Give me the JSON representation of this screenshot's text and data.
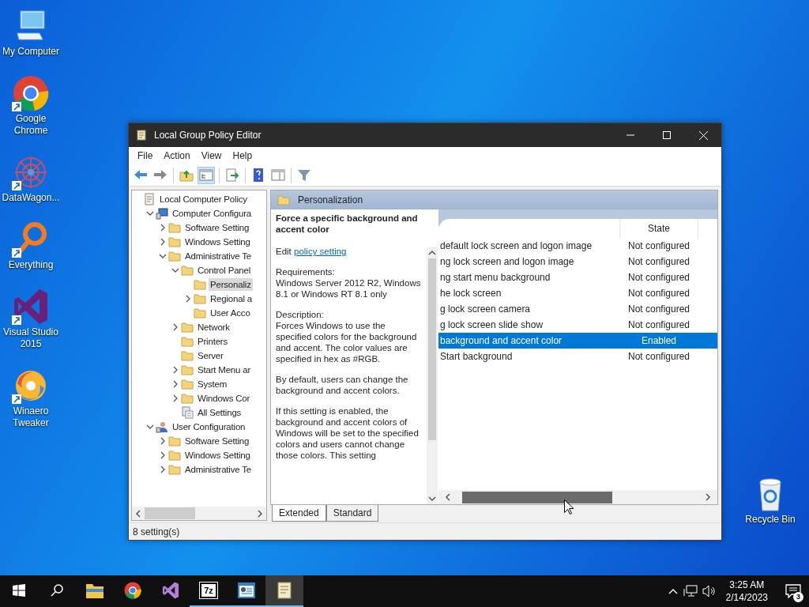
{
  "desktop_icons": [
    {
      "label": "My Computer",
      "kind": "computer",
      "shortcut": false
    },
    {
      "label": "Google Chrome",
      "kind": "chrome",
      "shortcut": true
    },
    {
      "label": "DataWagon...",
      "kind": "mandala",
      "shortcut": true
    },
    {
      "label": "Everything",
      "kind": "magnifier",
      "shortcut": true
    },
    {
      "label": "Visual Studio 2015",
      "kind": "vs",
      "shortcut": true
    },
    {
      "label": "Winaero Tweaker",
      "kind": "swirl",
      "shortcut": true
    },
    {
      "label": "Recycle Bin",
      "kind": "bin",
      "shortcut": false
    }
  ],
  "window": {
    "title": "Local Group Policy Editor",
    "menu": [
      "File",
      "Action",
      "View",
      "Help"
    ],
    "toolbar": [
      {
        "kind": "back"
      },
      {
        "kind": "forward"
      },
      {
        "kind": "sep"
      },
      {
        "kind": "up",
        "selected": false
      },
      {
        "kind": "tree",
        "selected": true
      },
      {
        "kind": "sep"
      },
      {
        "kind": "export",
        "selected": false
      },
      {
        "kind": "sep"
      },
      {
        "kind": "help",
        "selected": false
      },
      {
        "kind": "pane",
        "selected": false
      },
      {
        "kind": "sep"
      },
      {
        "kind": "filter",
        "selected": false
      }
    ],
    "tree": [
      {
        "label": "Local Computer Policy",
        "kind": "policy",
        "selected": false,
        "children": [
          {
            "label": "Computer Configura",
            "kind": "computer",
            "expanded": true,
            "selected": false,
            "children": [
              {
                "label": "Software Setting",
                "kind": "folder",
                "expanded": false,
                "selected": false
              },
              {
                "label": "Windows Setting",
                "kind": "folder",
                "expanded": false,
                "selected": false
              },
              {
                "label": "Administrative Te",
                "kind": "folder",
                "expanded": true,
                "selected": false,
                "children": [
                  {
                    "label": "Control Panel",
                    "kind": "folder",
                    "expanded": true,
                    "selected": false,
                    "children": [
                      {
                        "label": "Personaliz",
                        "kind": "folder",
                        "selected": true
                      },
                      {
                        "label": "Regional a",
                        "kind": "folder",
                        "expanded": false,
                        "selected": false
                      },
                      {
                        "label": "User Acco",
                        "kind": "folder",
                        "selected": false
                      }
                    ]
                  },
                  {
                    "label": "Network",
                    "kind": "folder",
                    "expanded": false,
                    "selected": false
                  },
                  {
                    "label": "Printers",
                    "kind": "folder",
                    "selected": false
                  },
                  {
                    "label": "Server",
                    "kind": "folder",
                    "selected": false
                  },
                  {
                    "label": "Start Menu ar",
                    "kind": "folder",
                    "expanded": false,
                    "selected": false
                  },
                  {
                    "label": "System",
                    "kind": "folder",
                    "expanded": false,
                    "selected": false
                  },
                  {
                    "label": "Windows Cor",
                    "kind": "folder",
                    "expanded": false,
                    "selected": false
                  },
                  {
                    "label": "All Settings",
                    "kind": "settings",
                    "selected": false
                  }
                ]
              }
            ]
          },
          {
            "label": "User Configuration",
            "kind": "user",
            "expanded": true,
            "selected": false,
            "children": [
              {
                "label": "Software Setting",
                "kind": "folder",
                "expanded": false,
                "selected": false
              },
              {
                "label": "Windows Setting",
                "kind": "folder",
                "expanded": false,
                "selected": false
              },
              {
                "label": "Administrative Te",
                "kind": "folder",
                "expanded": false,
                "selected": false
              }
            ]
          }
        ]
      }
    ],
    "pane_header": "Personalization",
    "description": {
      "title": "Force a specific background and accent color",
      "edit_prefix": "Edit",
      "edit_link": "policy setting",
      "paragraphs": [
        "Requirements:\nWindows Server 2012 R2, Windows 8.1 or Windows RT 8.1 only",
        "Description:\nForces Windows to use the specified colors for the background and accent. The color values are specified in hex as #RGB.",
        "By default, users can change the background and accent colors.",
        "If this setting is enabled, the background and accent colors of Windows will be set to the specified colors and users cannot change those colors. This setting"
      ]
    },
    "list": {
      "columns": [
        "State"
      ],
      "rows": [
        {
          "name": "default lock screen and logon image",
          "state": "Not configured",
          "selected": false
        },
        {
          "name": "ng lock screen and logon image",
          "state": "Not configured",
          "selected": false
        },
        {
          "name": "ng start menu background",
          "state": "Not configured",
          "selected": false
        },
        {
          "name": "he lock screen",
          "state": "Not configured",
          "selected": false
        },
        {
          "name": "g lock screen camera",
          "state": "Not configured",
          "selected": false
        },
        {
          "name": "g lock screen slide show",
          "state": "Not configured",
          "selected": false
        },
        {
          "name": "background and accent color",
          "state": "Enabled",
          "selected": true
        },
        {
          "name": "Start background",
          "state": "Not configured",
          "selected": false
        }
      ]
    },
    "tabs": [
      {
        "label": "Extended",
        "selected": true
      },
      {
        "label": "Standard",
        "selected": false
      }
    ],
    "status_bar": "8 setting(s)"
  },
  "taskbar": {
    "items": [
      {
        "kind": "start",
        "active": false,
        "selected": false
      },
      {
        "kind": "search",
        "active": false,
        "selected": false
      },
      {
        "kind": "explorer",
        "active": false,
        "selected": false
      },
      {
        "kind": "chrome",
        "active": false,
        "selected": false
      },
      {
        "kind": "vs",
        "active": false,
        "selected": false
      },
      {
        "kind": "sevenzip",
        "text": "7z",
        "active": true,
        "selected": false
      },
      {
        "kind": "config",
        "active": true,
        "selected": false
      },
      {
        "kind": "scroll",
        "active": true,
        "selected": true
      }
    ],
    "time": "3:25 AM",
    "date": "2/14/2023",
    "notifications": "3"
  }
}
